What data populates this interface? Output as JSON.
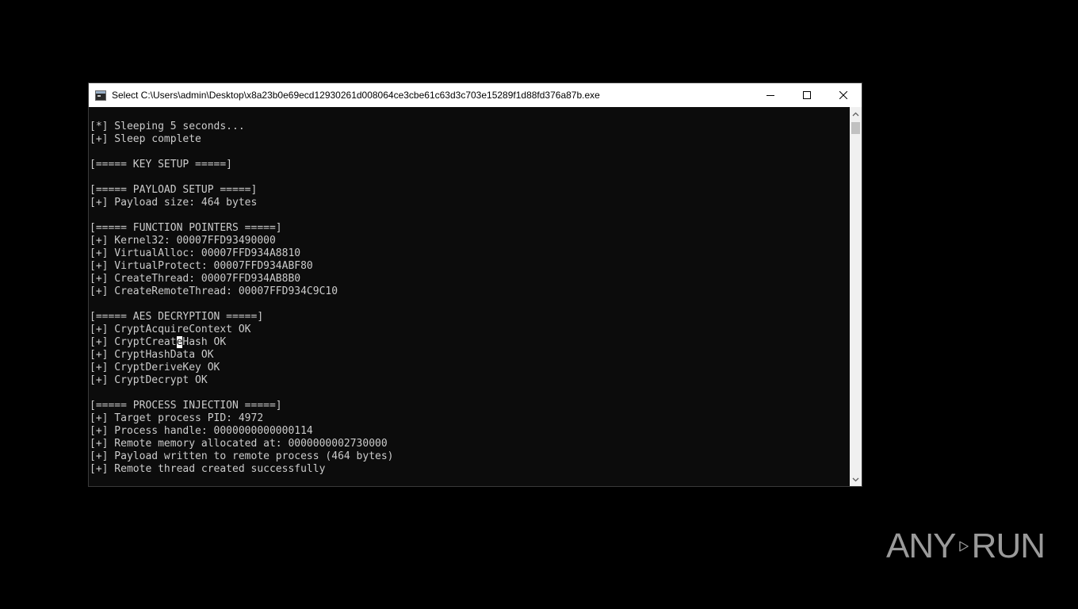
{
  "window": {
    "title": "Select C:\\Users\\admin\\Desktop\\x8a23b0e69ecd12930261d008064ce3cbe61c63d3c703e15289f1d88fd376a87b.exe",
    "app_icon": "console-icon",
    "controls": {
      "minimize_icon": "minimize-icon",
      "maximize_icon": "maximize-icon",
      "close_icon": "close-icon"
    }
  },
  "console": {
    "lines": [
      "[*] Sleeping 5 seconds...",
      "[+] Sleep complete",
      "",
      "[===== KEY SETUP =====]",
      "",
      "[===== PAYLOAD SETUP =====]",
      "[+] Payload size: 464 bytes",
      "",
      "[===== FUNCTION POINTERS =====]",
      "[+] Kernel32: 00007FFD93490000",
      "[+] VirtualAlloc: 00007FFD934A8810",
      "[+] VirtualProtect: 00007FFD934ABF80",
      "[+] CreateThread: 00007FFD934AB8B0",
      "[+] CreateRemoteThread: 00007FFD934C9C10",
      "",
      "[===== AES DECRYPTION =====]",
      "[+] CryptAcquireContext OK",
      "[+] CryptCreateHash OK",
      "[+] CryptHashData OK",
      "[+] CryptDeriveKey OK",
      "[+] CryptDecrypt OK",
      "",
      "[===== PROCESS INJECTION =====]",
      "[+] Target process PID: 4972",
      "[+] Process handle: 0000000000000114",
      "[+] Remote memory allocated at: 0000000002730000",
      "[+] Payload written to remote process (464 bytes)",
      "[+] Remote thread created successfully"
    ],
    "selection_line": 17,
    "selection_char": "e",
    "colors": {
      "background": "#0c0c0c",
      "text": "#cccccc",
      "selection": "#ffffff"
    }
  },
  "scrollbar": {
    "up_icon": "scroll-up-icon",
    "down_icon": "scroll-down-icon"
  },
  "watermark": {
    "text_left": "ANY",
    "text_right": "RUN",
    "icon": "play-icon",
    "color": "#9a9a9a"
  }
}
